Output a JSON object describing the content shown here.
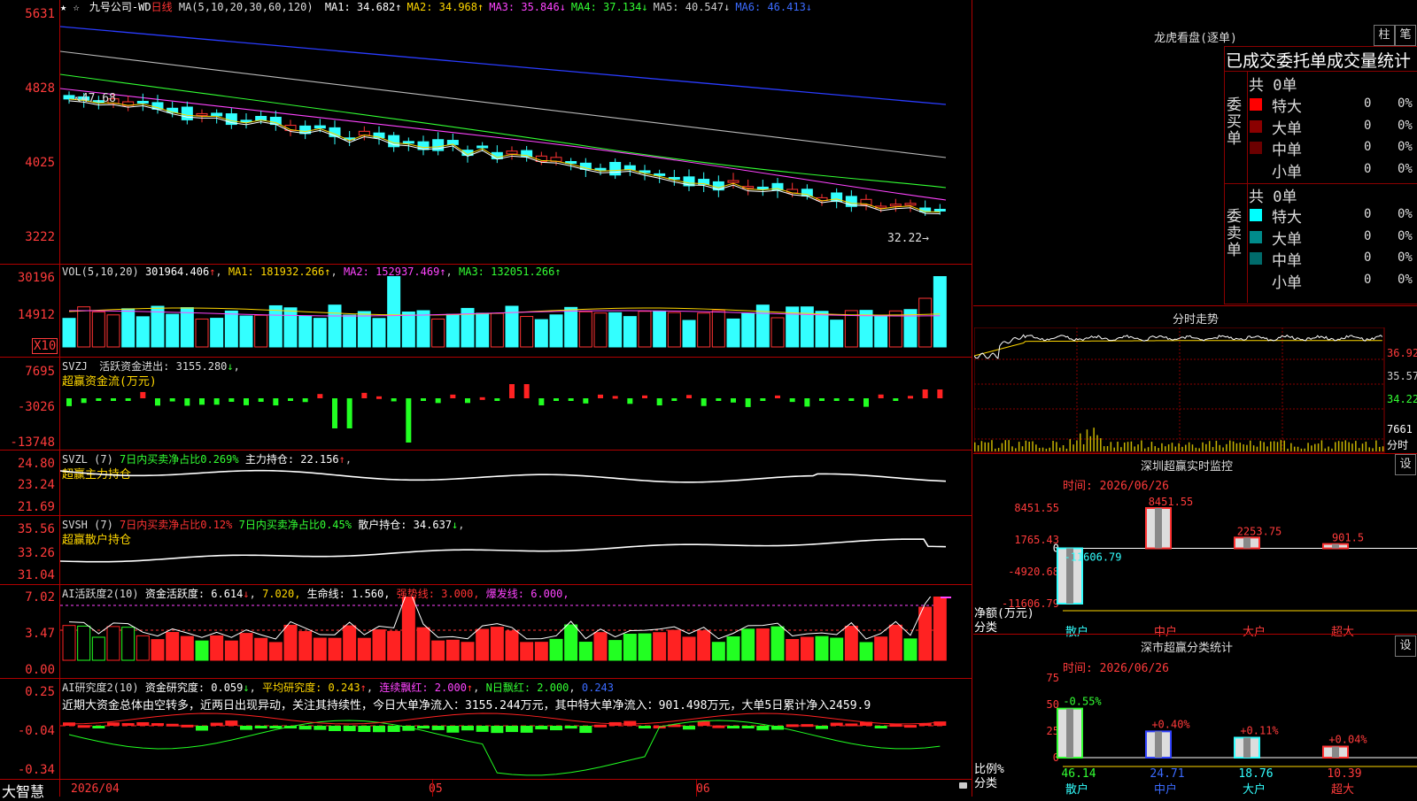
{
  "header": {
    "stars": "★ ☆",
    "stock_name": "九号公司-WD",
    "period": "日线",
    "ma_label": "MA(5,10,20,30,60,120)",
    "ma": [
      {
        "label": "MA1:",
        "value": "34.682",
        "arrow": "↑",
        "color": "#ffffff"
      },
      {
        "label": "MA2:",
        "value": "34.968",
        "arrow": "↑",
        "color": "#ffd700"
      },
      {
        "label": "MA3:",
        "value": "35.846",
        "arrow": "↓",
        "color": "#ff44ff"
      },
      {
        "label": "MA4:",
        "value": "37.134",
        "arrow": "↓",
        "color": "#33ff33"
      },
      {
        "label": "MA5:",
        "value": "40.547",
        "arrow": "↓",
        "color": "#cccccc"
      },
      {
        "label": "MA6:",
        "value": "46.413",
        "arrow": "↓",
        "color": "#3b6bff"
      }
    ]
  },
  "price_axis": [
    "5631",
    "4828",
    "4025",
    "3222"
  ],
  "price_marks": {
    "high": "47.68",
    "low": "32.22"
  },
  "vol": {
    "title": "VOL(5,10,20)",
    "value": "301964.406",
    "ma1": "181932.266",
    "ma2": "152937.469",
    "ma3": "132051.266",
    "axis": [
      "30196",
      "14912"
    ],
    "unit": "X10"
  },
  "svzj": {
    "title": "SVZJ",
    "label": "活跃资金进出:",
    "value": "3155.280",
    "sub": "超赢资金流(万元)",
    "axis": [
      "7695",
      "-3026",
      "-13748"
    ]
  },
  "svzl": {
    "title": "SVZL (7)",
    "stat1": "7日内买卖净占比0.269%",
    "stat2": "主力持仓: 22.156",
    "sub": "超赢主力持仓",
    "axis": [
      "24.80",
      "23.24",
      "21.69"
    ]
  },
  "svsh": {
    "title": "SVSH (7)",
    "stat1": "7日内买卖净占比0.12%",
    "stat2": "7日内买卖净占比0.45%",
    "stat3": "散户持仓: 34.637",
    "sub": "超赢散户持仓",
    "axis": [
      "35.56",
      "33.26",
      "31.04"
    ]
  },
  "ai1": {
    "title": "AI活跃度2(10)",
    "a": "资金活跃度: 6.614",
    "b": "7.020,",
    "c": "生命线: 1.560,",
    "d": "强势线: 3.000,",
    "e": "爆发线: 6.000,",
    "axis": [
      "7.02",
      "3.47",
      "0.00"
    ]
  },
  "ai2": {
    "title": "AI研究度2(10)",
    "a": "资金研究度: 0.059",
    "b": "平均研究度: 0.243",
    "c": "连续飘红: 2.000",
    "d": "N日飘红: 2.000",
    "e": "0.243",
    "text": "近期大资金总体由空转多，近两日出现异动，关注其持续性，今日大单净流入：3155.244万元，其中特大单净流入：901.498万元，大单5日累计净入2459.9",
    "axis": [
      "0.25",
      "-0.04",
      "-0.34"
    ]
  },
  "dates": [
    "2026/04",
    "05",
    "06"
  ],
  "brand": "大智慧",
  "right": {
    "title": "龙虎看盘(逐单)",
    "btn1": "柱",
    "btn2": "笔",
    "header": "已成交委托单成交量统计",
    "buy_side": "委买单",
    "sell_side": "委卖单",
    "buy_total": "共 0单",
    "sell_total": "共 0单",
    "rows_buy": [
      {
        "label": "特大",
        "n": "0",
        "pct": "0%",
        "color": "#ff0000"
      },
      {
        "label": "大单",
        "n": "0",
        "pct": "0%",
        "color": "#8b0000"
      },
      {
        "label": "中单",
        "n": "0",
        "pct": "0%",
        "color": "#6b0000"
      },
      {
        "label": "小单",
        "n": "0",
        "pct": "0%",
        "color": "#000000"
      }
    ],
    "rows_sell": [
      {
        "label": "特大",
        "n": "0",
        "pct": "0%",
        "color": "#00ffff"
      },
      {
        "label": "大单",
        "n": "0",
        "pct": "0%",
        "color": "#008b8b"
      },
      {
        "label": "中单",
        "n": "0",
        "pct": "0%",
        "color": "#006b6b"
      },
      {
        "label": "小单",
        "n": "0",
        "pct": "0%",
        "color": "#000000"
      }
    ],
    "fenshi_title": "分时走势",
    "fenshi_axis": [
      "36.92",
      "35.57",
      "34.22",
      "7661",
      "分时"
    ],
    "monitor_title": "深圳超赢实时监控",
    "monitor_time": "时间: 2026/06/26",
    "monitor_btn": "设",
    "monitor_axis": [
      "8451.55",
      "1765.43",
      "0",
      "-4920.68",
      "-11606.79"
    ],
    "monitor_side": [
      "净额(万元)",
      "分类"
    ],
    "stat_title": "深市超赢分类统计",
    "stat_time": "时间: 2026/06/26",
    "stat_btn": "设",
    "stat_axis": [
      "75",
      "50",
      "25",
      "0"
    ],
    "stat_side": [
      "比例%",
      "分类"
    ]
  },
  "chart_data": [
    {
      "type": "bar",
      "title": "深圳超赢实时监控",
      "ylabel": "净额(万元)",
      "categories": [
        "散户",
        "中户",
        "大户",
        "超大"
      ],
      "values": [
        -11606.79,
        8451.55,
        2253.75,
        901.5
      ],
      "labels": [
        "-11606.79",
        "8451.55",
        "2253.75",
        "901.5"
      ],
      "ylim": [
        -11606.79,
        8451.55
      ]
    },
    {
      "type": "bar",
      "title": "深市超赢分类统计",
      "ylabel": "比例%",
      "categories": [
        "散户",
        "中户",
        "大户",
        "超大"
      ],
      "values": [
        46.14,
        24.71,
        18.76,
        10.39
      ],
      "changes": [
        "-0.55%",
        "+0.40%",
        "+0.11%",
        "+0.04%"
      ],
      "ylim": [
        0,
        75
      ]
    }
  ]
}
